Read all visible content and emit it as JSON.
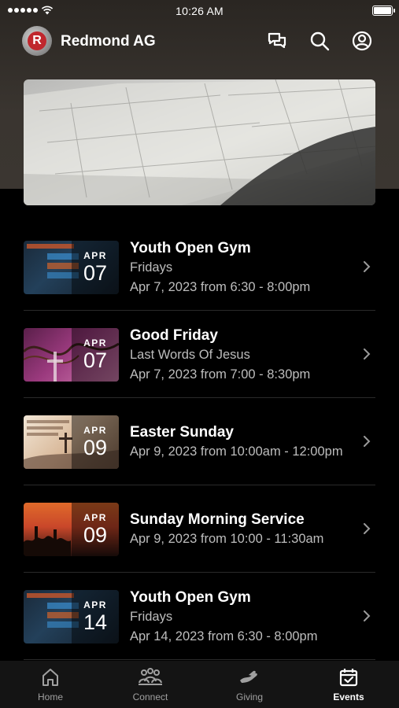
{
  "status_bar": {
    "time": "10:26 AM"
  },
  "header": {
    "logo_letter": "R",
    "title": "Redmond AG"
  },
  "events": [
    {
      "title": "Youth Open Gym",
      "subtitle": "Fridays",
      "date_line": "Apr 7, 2023 from 6:30 - 8:00pm",
      "month": "APR",
      "day": "07"
    },
    {
      "title": "Good Friday",
      "subtitle": "Last Words Of Jesus",
      "date_line": "Apr 7, 2023 from 7:00 - 8:30pm",
      "month": "APR",
      "day": "07"
    },
    {
      "title": "Easter Sunday",
      "subtitle": "",
      "date_line": "Apr 9, 2023 from 10:00am - 12:00pm",
      "month": "APR",
      "day": "09"
    },
    {
      "title": "Sunday Morning Service",
      "subtitle": "",
      "date_line": "Apr 9, 2023 from 10:00 - 11:30am",
      "month": "APR",
      "day": "09"
    },
    {
      "title": "Youth Open Gym",
      "subtitle": "Fridays",
      "date_line": "Apr 14, 2023 from 6:30 - 8:00pm",
      "month": "APR",
      "day": "14"
    }
  ],
  "tabs": [
    {
      "label": "Home",
      "icon": "home-icon",
      "active": false
    },
    {
      "label": "Connect",
      "icon": "people-icon",
      "active": false
    },
    {
      "label": "Giving",
      "icon": "giving-hands-icon",
      "active": false
    },
    {
      "label": "Events",
      "icon": "calendar-check-icon",
      "active": true
    }
  ],
  "colors": {
    "background": "#000000",
    "header_bg": "#3a3530",
    "tabbar_bg": "#141414",
    "muted_text": "#bdbdbd"
  }
}
